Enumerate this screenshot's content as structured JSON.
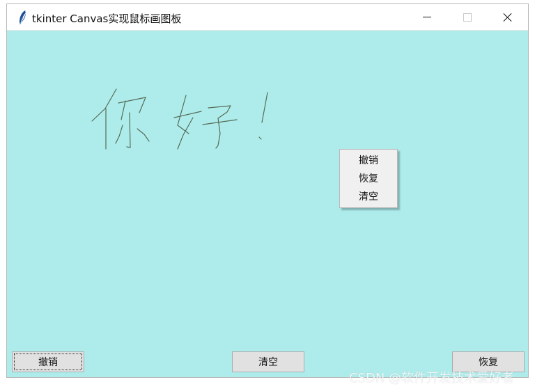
{
  "window": {
    "title": "tkinter Canvas实现鼠标画图板"
  },
  "canvas": {
    "background": "#aeecec",
    "stroke_color": "#556b55",
    "handwriting_text": "你好！"
  },
  "context_menu": {
    "items": [
      "撤销",
      "恢复",
      "清空"
    ]
  },
  "buttons": {
    "undo_label": "撤销",
    "clear_label": "清空",
    "redo_label": "恢复"
  },
  "watermark": {
    "text": "CSDN @软件开发技术爱好者"
  }
}
